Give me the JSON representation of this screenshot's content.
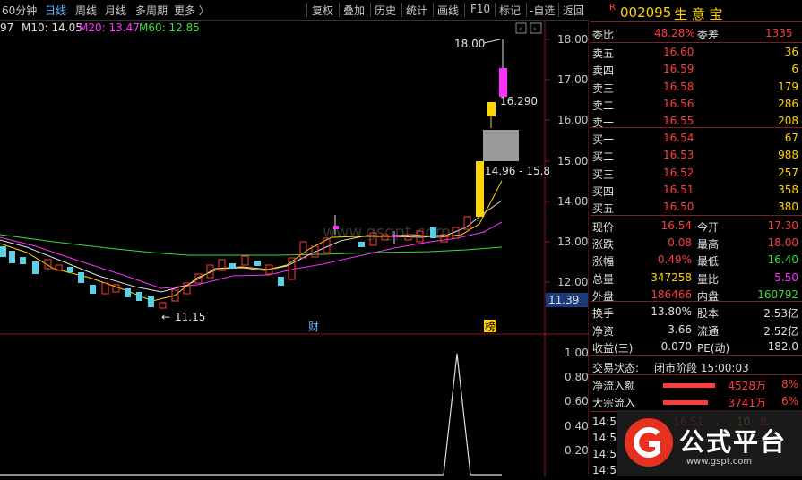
{
  "toolbar": {
    "items": [
      "60分钟",
      "日线",
      "周线",
      "月线",
      "多周期",
      "更多 〉",
      "复权",
      "叠加",
      "历史",
      "统计",
      "画线",
      "F10",
      "标记",
      "-自选",
      "返回"
    ],
    "active": "日线"
  },
  "ma": {
    "partial": "97",
    "m10": "M10: 14.05",
    "m20": "M20: 13.47",
    "m60": "M60: 12.85"
  },
  "stock": {
    "badge": "R",
    "code": "002095",
    "name": "生 意 宝"
  },
  "price_axis": [
    "18.00",
    "17.00",
    "16.00",
    "15.00",
    "14.00",
    "13.00",
    "12.00"
  ],
  "current_price_tag": "11.39",
  "volume_axis": [
    "1.00",
    "0.80",
    "0.60",
    "0.40",
    "0.20"
  ],
  "annotations": {
    "high": "18.00",
    "low": "11.15",
    "last": "16.290",
    "gap": "14.96 - 15.8",
    "marker_cai": "财",
    "marker_bang": "榜"
  },
  "watermark": "www.gsgpt.com",
  "order_book": {
    "ratio_label": "委比",
    "ratio_value": "48.28%",
    "diff_label": "委差",
    "diff_value": "1335",
    "asks": [
      {
        "label": "卖五",
        "price": "16.60",
        "vol": "36"
      },
      {
        "label": "卖四",
        "price": "16.59",
        "vol": "6"
      },
      {
        "label": "卖三",
        "price": "16.58",
        "vol": "179"
      },
      {
        "label": "卖二",
        "price": "16.56",
        "vol": "286"
      },
      {
        "label": "卖一",
        "price": "16.55",
        "vol": "208"
      }
    ],
    "bids": [
      {
        "label": "买一",
        "price": "16.54",
        "vol": "67"
      },
      {
        "label": "买二",
        "price": "16.53",
        "vol": "988"
      },
      {
        "label": "买三",
        "price": "16.52",
        "vol": "257"
      },
      {
        "label": "买四",
        "price": "16.51",
        "vol": "358"
      },
      {
        "label": "买五",
        "price": "16.50",
        "vol": "380"
      }
    ]
  },
  "quote": [
    {
      "l1": "现价",
      "v1": "16.54",
      "l2": "今开",
      "v2": "17.30"
    },
    {
      "l1": "涨跌",
      "v1": "0.08",
      "l2": "最高",
      "v2": "18.00"
    },
    {
      "l1": "涨幅",
      "v1": "0.49%",
      "l2": "最低",
      "v2": "16.40"
    },
    {
      "l1": "总量",
      "v1": "347258",
      "l2": "量比",
      "v2": "5.50"
    },
    {
      "l1": "外盘",
      "v1": "186466",
      "l2": "内盘",
      "v2": "160792"
    }
  ],
  "fundamentals": [
    {
      "l1": "换手",
      "v1": "13.80%",
      "l2": "股本",
      "v2": "2.53亿"
    },
    {
      "l1": "净资",
      "v1": "3.66",
      "l2": "流通",
      "v2": "2.52亿"
    },
    {
      "l1": "收益(三)",
      "v1": "0.070",
      "l2": "PE(动)",
      "v2": "182.0"
    }
  ],
  "status": {
    "label": "交易状态:",
    "value": "闭市阶段 15:00:03"
  },
  "flows": [
    {
      "label": "净流入额",
      "value": "4528万",
      "pct": "8%"
    },
    {
      "label": "大宗流入",
      "value": "3741万",
      "pct": "6%"
    }
  ],
  "ticks": [
    "14:5",
    "14:5",
    "14:5",
    "14:5"
  ],
  "tick_partial": {
    "price": "16.51",
    "vol": "10",
    "dir": "B"
  },
  "logo": {
    "text": "公式平台",
    "url": "www.gspt.com"
  },
  "colors": {
    "up": "#ff3c3c",
    "down": "#5ad2e6",
    "limit": "#ffd400",
    "accent": "#ff30ff"
  }
}
